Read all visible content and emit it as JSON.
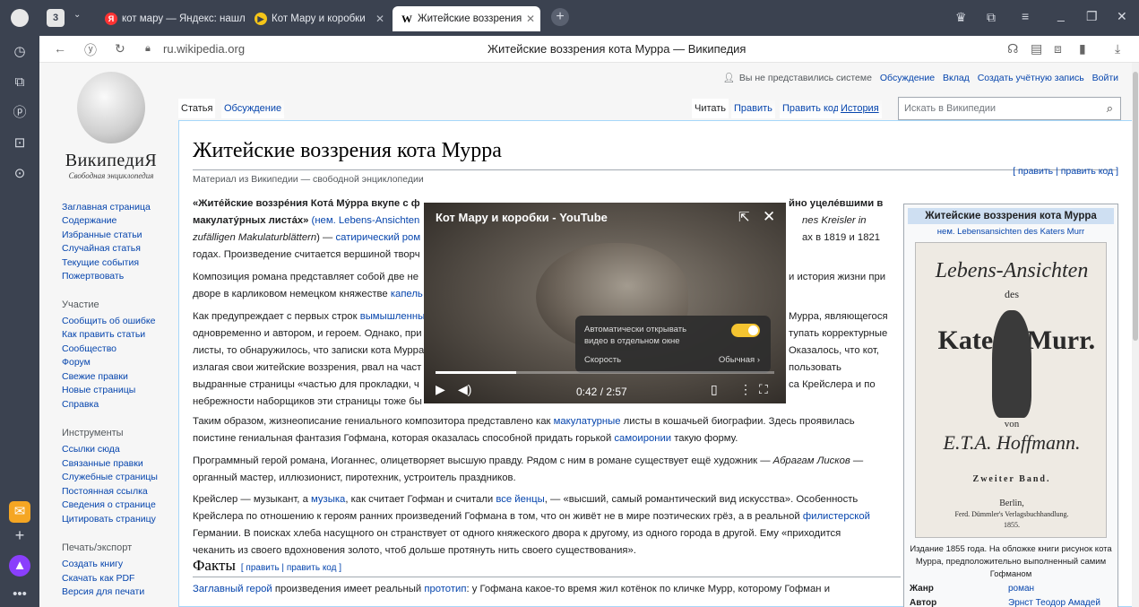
{
  "browser": {
    "tabs": [
      {
        "label": "кот мару — Яндекс: нашл",
        "favicon_color": "#f33",
        "favicon": "Я"
      },
      {
        "label": "Кот Мару и коробки",
        "favicon_color": "#f5c518",
        "favicon": "▶"
      },
      {
        "label": "Житейские воззрения",
        "favicon_color": "#fff",
        "favicon": "W"
      }
    ],
    "tab_count": "3",
    "url": "ru.wikipedia.org",
    "page_title": "Житейские воззрения кота Мурра — Википедия"
  },
  "wiki": {
    "wordmark": "ВикипедиЯ",
    "tagline": "Свободная энциклопедия",
    "personal": {
      "anon": "Вы не представились системе",
      "talk": "Обсуждение",
      "contrib": "Вклад",
      "create": "Создать учётную запись",
      "login": "Войти"
    },
    "tabs": {
      "article": "Статья",
      "discussion": "Обсуждение",
      "read": "Читать",
      "edit": "Править",
      "edit_code": "Править код",
      "history": "История"
    },
    "search_placeholder": "Искать в Википедии",
    "sidebar": {
      "nav": [
        "Заглавная страница",
        "Содержание",
        "Избранные статьи",
        "Случайная статья",
        "Текущие события",
        "Пожертвовать"
      ],
      "participation_head": "Участие",
      "participation": [
        "Сообщить об ошибке",
        "Как править статьи",
        "Сообщество",
        "Форум",
        "Свежие правки",
        "Новые страницы",
        "Справка"
      ],
      "tools_head": "Инструменты",
      "tools": [
        "Ссылки сюда",
        "Связанные правки",
        "Служебные страницы",
        "Постоянная ссылка",
        "Сведения о странице",
        "Цитировать страницу"
      ],
      "export_head": "Печать/экспорт",
      "export": [
        "Создать книгу",
        "Скачать как PDF",
        "Версия для печати"
      ]
    },
    "title": "Житейские воззрения кота Мурра",
    "sitesub": "Материал из Википедии — свободной энциклопедии",
    "edit_links": "[ править | править код ]",
    "paragraphs": {
      "p1_bold": "«Жите́йские воззре́ния Кота́ Му́рра вкупе с ф",
      "p1_bold_tail": "йно уцеле́вшими в",
      "p1_l2a": "макулату́рных листа́х»",
      "p1_l2b": " (нем. Lebens-Ansichten",
      "p1_l2c": "nes Kreisler in",
      "p1_l3a": "zufälligen Makulaturblättern",
      "p1_l3b": ") — ",
      "p1_l3link": "сатирический ром",
      "p1_l3c": "ах в 1819 и 1821",
      "p1_l4": "годах. Произведение считается вершиной творч",
      "p2_l1a": "Композиция романа представляет собой две не",
      "p2_l1b": "и история жизни при",
      "p2_l2a": "дворе в карликовом немецком княжестве ",
      "p2_l2link": "капель",
      "p3_l1a": "Как предупреждает с первых строк ",
      "p3_l1link": "вымышленны",
      "p3_l1b": "Мурра, являющегося",
      "p3_l2a": "одновременно и автором, и героем. Однако, при",
      "p3_l2b": "тупать корректурные",
      "p3_l3a": "листы, то обнаружилось, что записки кота Мурра",
      "p3_l3b": "Оказалось, что кот,",
      "p3_l4a": "излагая свои житейские воззрения, рвал на част",
      "p3_l4b": "пользовать",
      "p3_l5a": "выдранные страницы «частью для прокладки, ч",
      "p3_l5b": "са Крейслера и по",
      "p3_l6": "небрежности наборщиков эти страницы тоже бы",
      "p4_l1a": "Таким образом, жизнеописание гениального композитора представлено как ",
      "p4_l1link": "макулатурные",
      "p4_l1b": " листы в кошачьей биографии. Здесь проявилась",
      "p4_l2a": "поистине гениальная фантазия Гофмана, которая оказалась способной придать горькой ",
      "p4_l2link": "самоиронии",
      "p4_l2b": " такую форму.",
      "p5_l1a": "Программный герой романа, Иоганнес, олицетворяет высшую правду. Рядом с ним в романе существует ещё художник — ",
      "p5_l1i": "Абрагам Лисков",
      "p5_l1b": " —",
      "p5_l2": "органный мастер, иллюзионист, пиротехник, устроитель праздников.",
      "p6_l1a": "Крейслер — музыкант, а ",
      "p6_l1link1": "музыка",
      "p6_l1b": ", как считает Гофман и считали ",
      "p6_l1link2": "все йенцы",
      "p6_l1c": ", — «высший, самый романтический вид искусства». Особенность",
      "p6_l2a": "Крейслера по отношению к героям ранних произведений Гофмана в том, что он живёт не в мире поэтических грёз, а в реальной ",
      "p6_l2link": "филистерской",
      "p6_l3": "Германии. В поисках хлеба насущного он странствует от одного княжеского двора к другому, из одного города в другой. Ему «приходится",
      "p6_l4": "чеканить из своего вдохновения золото, чтоб дольше протянуть нить своего существования».",
      "p7_a": "Заглавный герой",
      "p7_b": " произведения имеет реальный ",
      "p7_link": "прототип",
      "p7_c": ": у Гофмана какое-то время жил котёнок по кличке Мурр, которому Гофман и"
    },
    "facts_heading": "Факты",
    "facts_edit": "[ править | править код ]",
    "infobox": {
      "title": "Житейские воззрения кота Мурра",
      "subtitle": "нем. Lebensansichten des Katers Murr",
      "cover_line1": "Lebens-Ansichten",
      "cover_line2": "des",
      "cover_line3": "Kater",
      "cover_line4": "Murr.",
      "cover_line5": "von",
      "cover_line6": "E.T.A. Hoffmann.",
      "cover_line7": "Zweiter Band.",
      "cover_line8": "Berlin,",
      "cover_line9": "Ferd. Dümmler's Verlagsbuchhandlung.",
      "cover_line10": "1855.",
      "caption": "Издание 1855 года. На обложке книги рисунок кота Мурра, предположительно выполненный самим Гофманом",
      "rows": [
        {
          "label": "Жанр",
          "value": "роман"
        },
        {
          "label": "Автор",
          "value": "Эрнст Теодор Амадей"
        }
      ]
    }
  },
  "video": {
    "title": "Кот Мару и коробки - YouTube",
    "auto_open_label": "Автоматически открывать видео в отдельном окне",
    "auto_open_on": true,
    "speed_label": "Скорость",
    "speed_value": "Обычная ›",
    "time": "0:42 / 2:57",
    "progress": 0.237
  }
}
